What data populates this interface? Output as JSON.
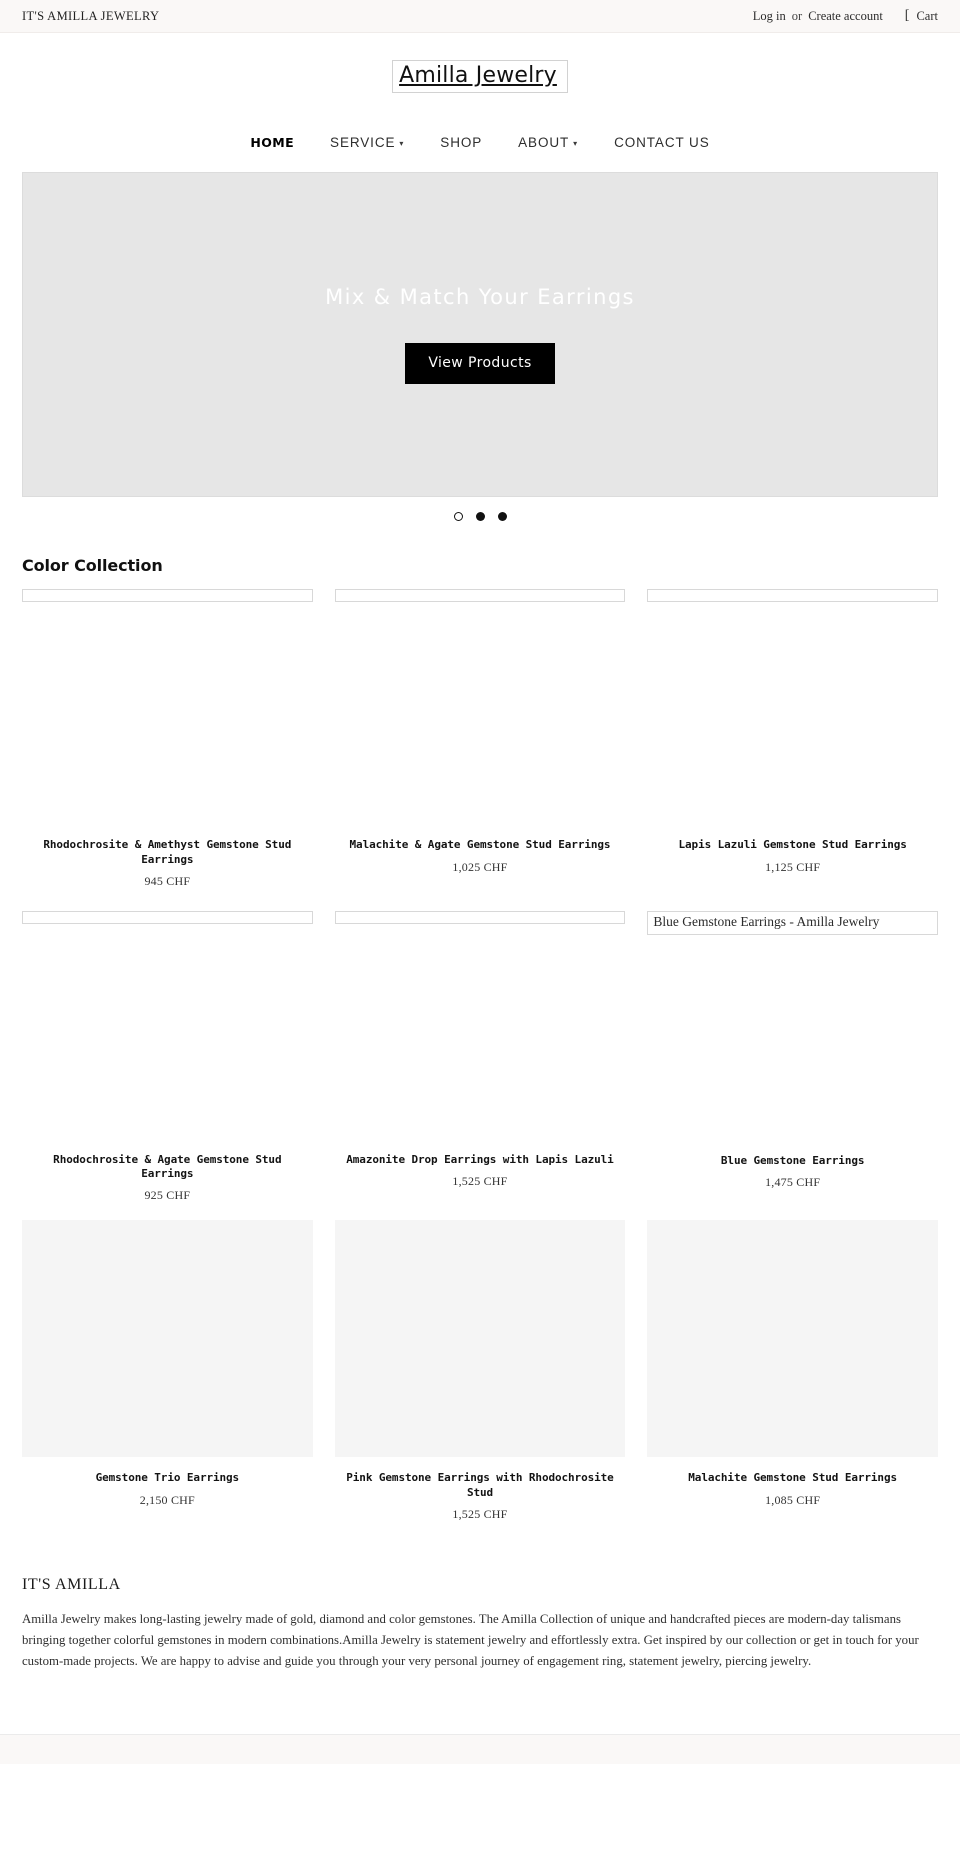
{
  "utility_bar": {
    "store_name": "IT'S AMILLA JEWELRY",
    "login_label": "Log in",
    "or_label": "or",
    "create_account_label": "Create account",
    "cart_separator": "[",
    "cart_label": "Cart"
  },
  "logo": {
    "alt_text": "Amilla Jewelry"
  },
  "nav": {
    "items": [
      {
        "label": "HOME",
        "caret": "",
        "active": true
      },
      {
        "label": "SERVICE",
        "caret": "▾",
        "active": false
      },
      {
        "label": "SHOP",
        "caret": "",
        "active": false
      },
      {
        "label": "ABOUT",
        "caret": "▾",
        "active": false
      },
      {
        "label": "CONTACT US",
        "caret": "",
        "active": false
      }
    ]
  },
  "hero": {
    "heading": "Mix & Match Your Earrings",
    "button_label": "View Products",
    "background_color": "#e6e6e6",
    "dots": [
      {
        "state": "hollow"
      },
      {
        "state": "filled"
      },
      {
        "state": "filled"
      }
    ]
  },
  "collection": {
    "title": "Color Collection",
    "products": [
      {
        "title": "Rhodochrosite & Amethyst Gemstone Stud Earrings",
        "price": "945 CHF",
        "image_alt": "",
        "image_state": "broken"
      },
      {
        "title": "Malachite & Agate Gemstone Stud Earrings",
        "price": "1,025 CHF",
        "image_alt": "",
        "image_state": "broken"
      },
      {
        "title": "Lapis Lazuli Gemstone Stud Earrings",
        "price": "1,125 CHF",
        "image_alt": "",
        "image_state": "broken"
      },
      {
        "title": "Rhodochrosite & Agate Gemstone Stud Earrings",
        "price": "925 CHF",
        "image_alt": "",
        "image_state": "broken"
      },
      {
        "title": "Amazonite Drop Earrings with Lapis Lazuli",
        "price": "1,525 CHF",
        "image_alt": "",
        "image_state": "broken"
      },
      {
        "title": "Blue Gemstone Earrings",
        "price": "1,475 CHF",
        "image_alt": "Blue Gemstone Earrings - Amilla Jewelry",
        "image_state": "broken-alt"
      },
      {
        "title": "Gemstone Trio Earrings",
        "price": "2,150 CHF",
        "image_alt": "",
        "image_state": "placeholder"
      },
      {
        "title": "Pink Gemstone Earrings with Rhodochrosite Stud",
        "price": "1,525 CHF",
        "image_alt": "",
        "image_state": "placeholder"
      },
      {
        "title": "Malachite Gemstone Stud Earrings",
        "price": "1,085 CHF",
        "image_alt": "",
        "image_state": "placeholder"
      }
    ]
  },
  "about": {
    "title": "IT'S AMILLA",
    "body": "Amilla Jewelry makes long-lasting jewelry made of gold, diamond and color gemstones. The Amilla Collection of unique and handcrafted pieces are modern-day talismans bringing together colorful gemstones in modern combinations.Amilla Jewelry is statement jewelry and effortlessly extra. Get inspired by our collection or get in touch for your custom-made projects. We are happy to advise and guide you through your very personal journey of engagement ring, statement jewelry, piercing jewelry."
  }
}
